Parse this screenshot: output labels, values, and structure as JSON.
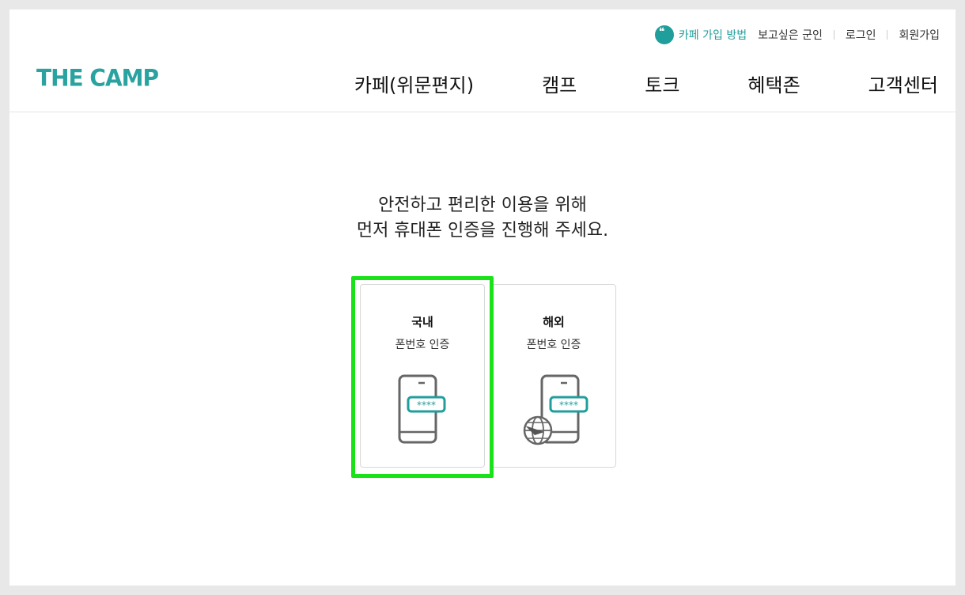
{
  "header": {
    "logo": "THE CAMP",
    "util": {
      "guide_label": "카페 가입 방법",
      "links": [
        "보고싶은 군인",
        "로그인",
        "회원가입"
      ]
    },
    "nav": [
      "카페(위문편지)",
      "캠프",
      "토크",
      "혜택존",
      "고객센터"
    ]
  },
  "main": {
    "intro_line1": "안전하고 편리한 이용을 위해",
    "intro_line2": "먼저 휴대폰 인증을 진행해 주세요.",
    "cards": [
      {
        "title": "국내",
        "subtitle": "폰번호 인증",
        "code": "****",
        "icon": "phone-password-icon"
      },
      {
        "title": "해외",
        "subtitle": "폰번호 인증",
        "code": "****",
        "icon": "phone-globe-password-icon"
      }
    ]
  },
  "colors": {
    "brand": "#1f9e9c",
    "highlight": "#19e219"
  }
}
